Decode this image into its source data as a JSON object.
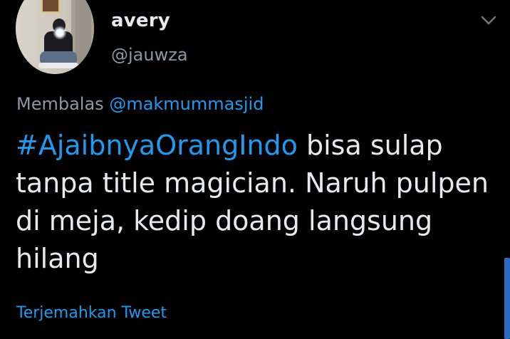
{
  "user": {
    "display_name": "avery",
    "handle": "@jauwza"
  },
  "reply": {
    "prefix": "Membalas",
    "mention": "@makmummasjid"
  },
  "tweet": {
    "hashtag": "#AjaibnyaOrangIndo",
    "line1_rest": " bisa sulap",
    "line2": "tanpa title magician. Naruh pulpen",
    "line3": "di meja, kedip doang langsung",
    "line4": "hilang"
  },
  "translate_label": "Terjemahkan Tweet",
  "icons": {
    "menu": "chevron-down-icon"
  },
  "colors": {
    "background": "#000000",
    "text": "#e7e9ea",
    "secondary": "#8b98a5",
    "accent": "#1d9bf0"
  }
}
